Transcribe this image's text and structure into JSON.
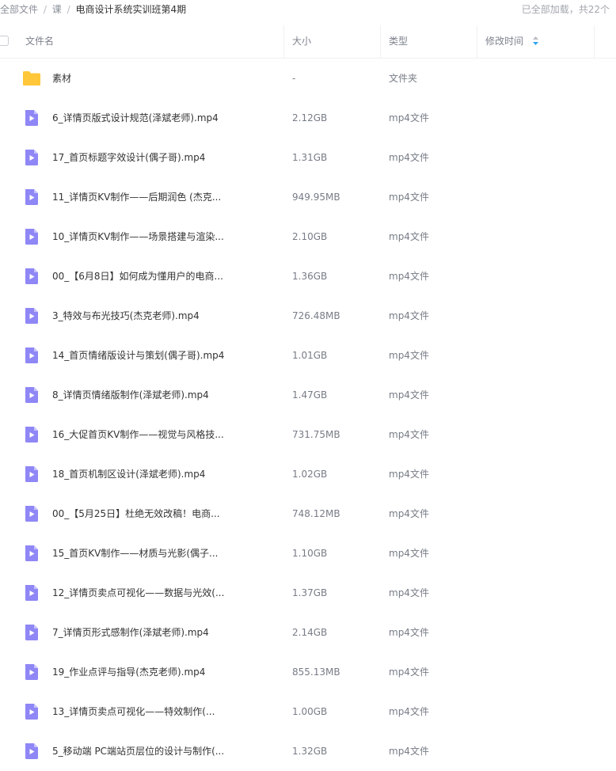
{
  "breadcrumb": {
    "items": [
      "全部文件",
      "课"
    ],
    "separator": "/",
    "current": "电商设计系统实训班第4期",
    "status": "已全部加载，共22个"
  },
  "columns": {
    "name": "文件名",
    "size": "大小",
    "type": "类型",
    "modified": "修改时间"
  },
  "colors": {
    "folder": "#ffc73a",
    "video_icon": "#8f87f6",
    "sort_icon_up": "#b9bcc2",
    "sort_icon_down": "#2fa3ef"
  },
  "files": [
    {
      "name": "素材",
      "size": "-",
      "type": "文件夹",
      "icon": "folder-icon"
    },
    {
      "name": "6_详情页版式设计规范(泽斌老师).mp4",
      "size": "2.12GB",
      "type": "mp4文件",
      "icon": "video-file-icon"
    },
    {
      "name": "17_首页标题字效设计(偶子哥).mp4",
      "size": "1.31GB",
      "type": "mp4文件",
      "icon": "video-file-icon"
    },
    {
      "name": "11_详情页KV制作——后期润色 (杰克...",
      "size": "949.95MB",
      "type": "mp4文件",
      "icon": "video-file-icon"
    },
    {
      "name": "10_详情页KV制作——场景搭建与渲染...",
      "size": "2.10GB",
      "type": "mp4文件",
      "icon": "video-file-icon"
    },
    {
      "name": "00_【6月8日】如何成为懂用户的电商...",
      "size": "1.36GB",
      "type": "mp4文件",
      "icon": "video-file-icon"
    },
    {
      "name": "3_特效与布光技巧(杰克老师).mp4",
      "size": "726.48MB",
      "type": "mp4文件",
      "icon": "video-file-icon"
    },
    {
      "name": "14_首页情绪版设计与策划(偶子哥).mp4",
      "size": "1.01GB",
      "type": "mp4文件",
      "icon": "video-file-icon"
    },
    {
      "name": "8_详情页情绪版制作(泽斌老师).mp4",
      "size": "1.47GB",
      "type": "mp4文件",
      "icon": "video-file-icon"
    },
    {
      "name": "16_大促首页KV制作——视觉与风格技...",
      "size": "731.75MB",
      "type": "mp4文件",
      "icon": "video-file-icon"
    },
    {
      "name": "18_首页机制区设计(泽斌老师).mp4",
      "size": "1.02GB",
      "type": "mp4文件",
      "icon": "video-file-icon"
    },
    {
      "name": "00_【5月25日】杜绝无效改稿！电商...",
      "size": "748.12MB",
      "type": "mp4文件",
      "icon": "video-file-icon"
    },
    {
      "name": "15_首页KV制作——材质与光影(偶子...",
      "size": "1.10GB",
      "type": "mp4文件",
      "icon": "video-file-icon"
    },
    {
      "name": "12_详情页卖点可视化——数据与光效(...",
      "size": "1.37GB",
      "type": "mp4文件",
      "icon": "video-file-icon"
    },
    {
      "name": "7_详情页形式感制作(泽斌老师).mp4",
      "size": "2.14GB",
      "type": "mp4文件",
      "icon": "video-file-icon"
    },
    {
      "name": "19_作业点评与指导(杰克老师).mp4",
      "size": "855.13MB",
      "type": "mp4文件",
      "icon": "video-file-icon"
    },
    {
      "name": "13_详情页卖点可视化——特效制作(...",
      "size": "1.00GB",
      "type": "mp4文件",
      "icon": "video-file-icon"
    },
    {
      "name": "5_移动端 PC端站页层位的设计与制作(...",
      "size": "1.32GB",
      "type": "mp4文件",
      "icon": "video-file-icon"
    }
  ]
}
